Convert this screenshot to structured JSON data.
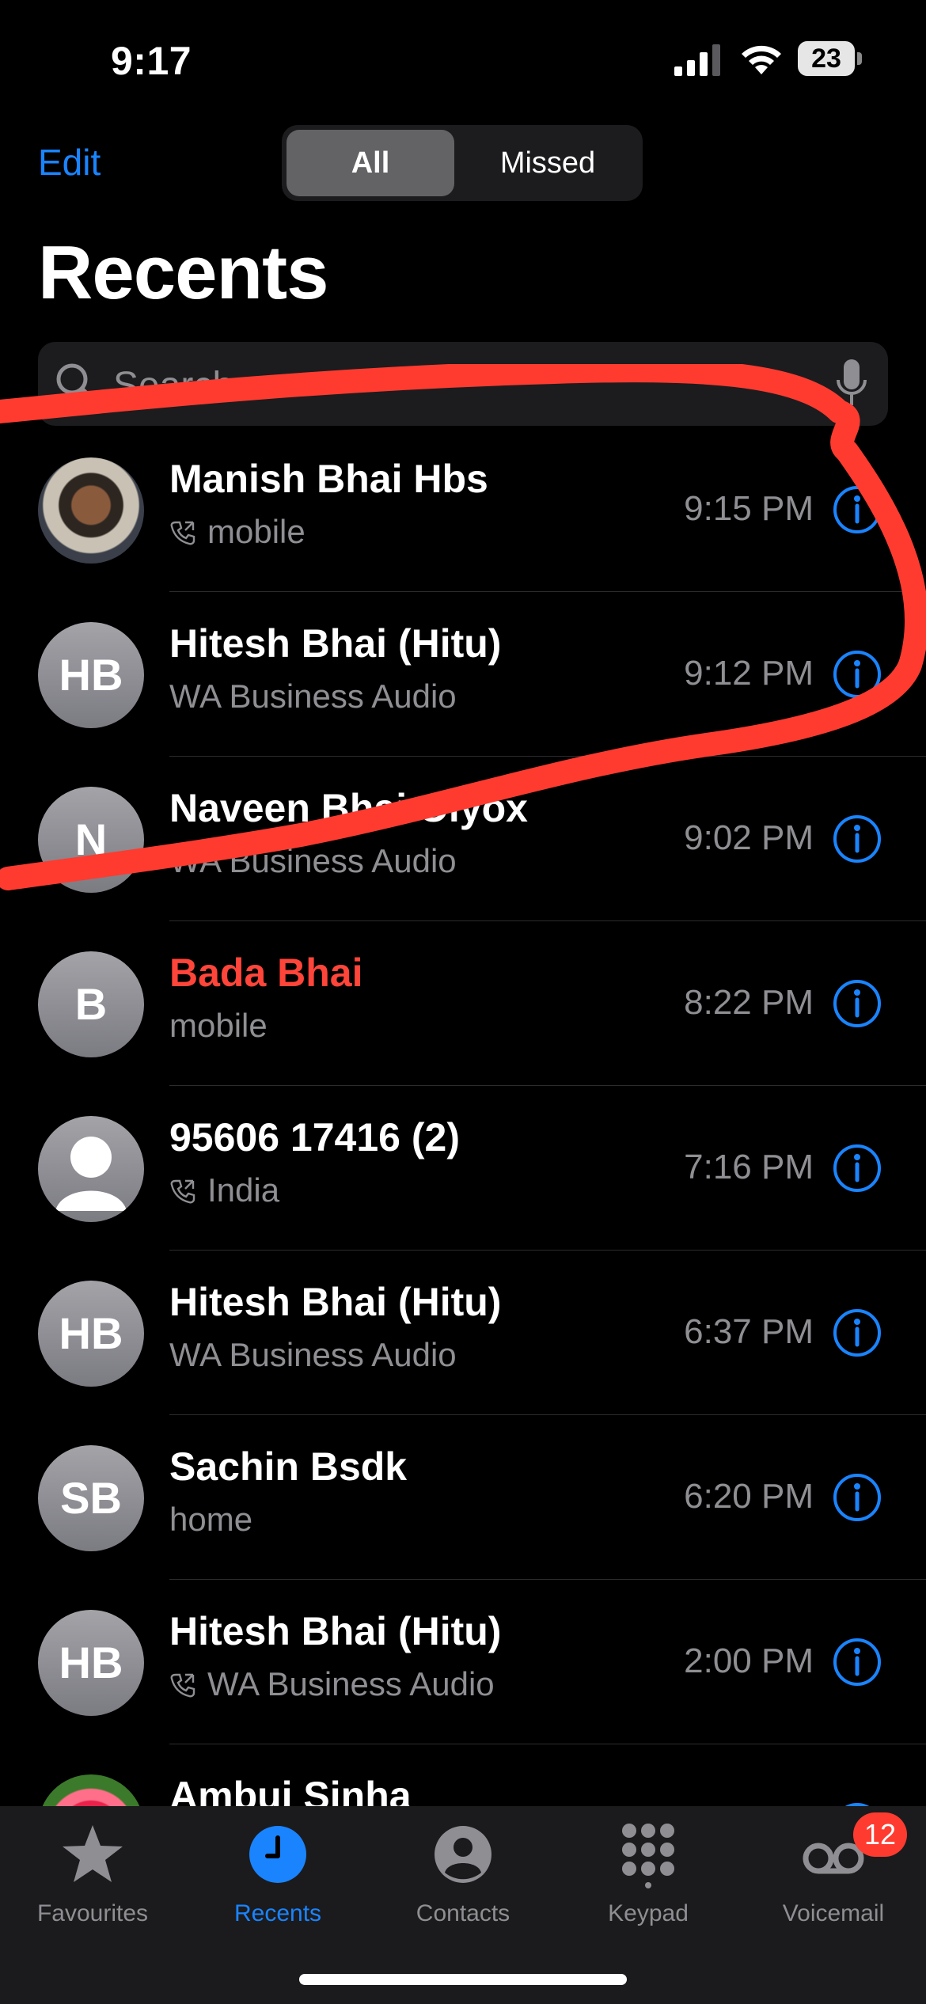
{
  "status": {
    "time": "9:17",
    "battery": "23"
  },
  "header": {
    "edit_label": "Edit",
    "segments": {
      "all": "All",
      "missed": "Missed"
    },
    "title": "Recents"
  },
  "search": {
    "placeholder": "Search"
  },
  "calls": [
    {
      "name": "Manish Bhai Hbs",
      "detail": "mobile",
      "time": "9:15 PM",
      "avatar_type": "photo",
      "initials": "",
      "missed": false,
      "phone_icon": true
    },
    {
      "name": "Hitesh Bhai (Hitu)",
      "detail": "WA Business Audio",
      "time": "9:12 PM",
      "avatar_type": "initials",
      "initials": "HB",
      "missed": false,
      "phone_icon": false
    },
    {
      "name": "Naveen Bhai Olyox",
      "detail": "WA Business Audio",
      "time": "9:02 PM",
      "avatar_type": "initials",
      "initials": "N",
      "missed": false,
      "phone_icon": false
    },
    {
      "name": "Bada Bhai",
      "detail": "mobile",
      "time": "8:22 PM",
      "avatar_type": "initials",
      "initials": "B",
      "missed": true,
      "phone_icon": false
    },
    {
      "name": "95606 17416 (2)",
      "detail": "India",
      "time": "7:16 PM",
      "avatar_type": "generic",
      "initials": "",
      "missed": false,
      "phone_icon": true
    },
    {
      "name": "Hitesh Bhai (Hitu)",
      "detail": "WA Business Audio",
      "time": "6:37 PM",
      "avatar_type": "initials",
      "initials": "HB",
      "missed": false,
      "phone_icon": false
    },
    {
      "name": "Sachin Bsdk",
      "detail": "home",
      "time": "6:20 PM",
      "avatar_type": "initials",
      "initials": "SB",
      "missed": false,
      "phone_icon": false
    },
    {
      "name": "Hitesh Bhai (Hitu)",
      "detail": "WA Business Audio",
      "time": "2:00 PM",
      "avatar_type": "initials",
      "initials": "HB",
      "missed": false,
      "phone_icon": true
    },
    {
      "name": "Ambuj Sinha",
      "detail": "",
      "time": "",
      "avatar_type": "photo-flower",
      "initials": "",
      "missed": false,
      "phone_icon": false
    }
  ],
  "tabbar": {
    "tabs": [
      {
        "label": "Favourites",
        "icon": "star-icon"
      },
      {
        "label": "Recents",
        "icon": "clock-icon"
      },
      {
        "label": "Contacts",
        "icon": "person-circle-icon"
      },
      {
        "label": "Keypad",
        "icon": "keypad-icon"
      },
      {
        "label": "Voicemail",
        "icon": "voicemail-icon"
      }
    ],
    "active": "Recents",
    "voicemail_badge": "12"
  },
  "colors": {
    "accent": "#1a84ff",
    "missed": "#ff453a",
    "annotation": "#ff3b30"
  }
}
